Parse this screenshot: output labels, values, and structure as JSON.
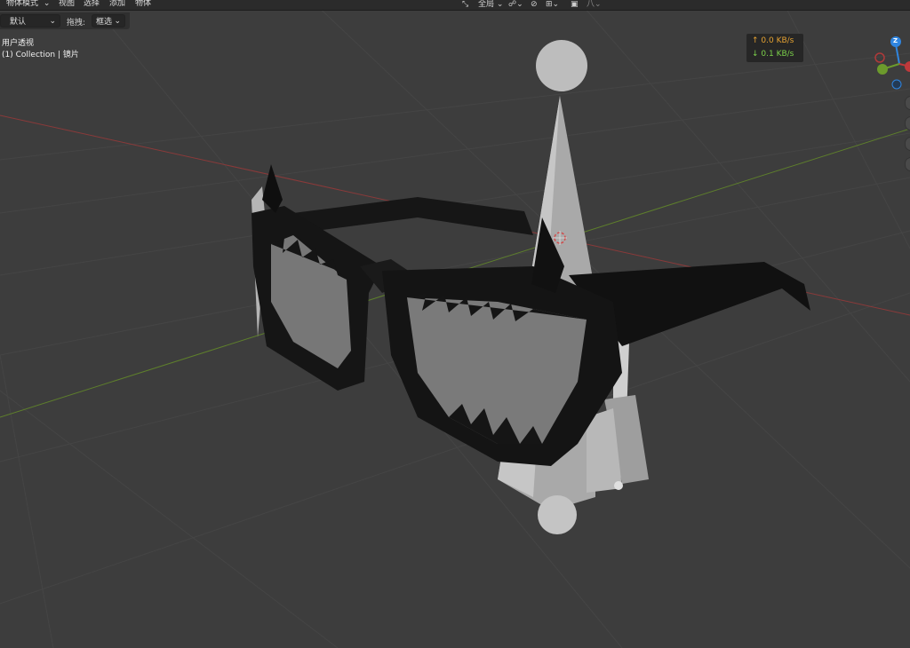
{
  "header": {
    "mode_label": "物体模式",
    "menus": [
      "视图",
      "选择",
      "添加",
      "物体"
    ],
    "orientation_label": "全局"
  },
  "toolbar": {
    "orientation_value": "默认",
    "drag_label": "拖拽:",
    "drag_value": "框选"
  },
  "viewport": {
    "view_name": "用户透视",
    "collection_info": "(1) Collection | 镜片"
  },
  "network": {
    "upload": "↑ 0.0 KB/s",
    "download": "↓ 0.1 KB/s"
  },
  "gizmo": {
    "z_label": "Z"
  },
  "colors": {
    "x_axis": "#c0393b",
    "y_axis": "#6c9a2c",
    "z_axis": "#2f85e0",
    "upload": "#e6a332",
    "download": "#7bd04a"
  },
  "icons": [
    "select-mode-icon",
    "orientation-icon",
    "snap-icon",
    "proportional-icon",
    "overlay-icon",
    "shading-icon"
  ]
}
